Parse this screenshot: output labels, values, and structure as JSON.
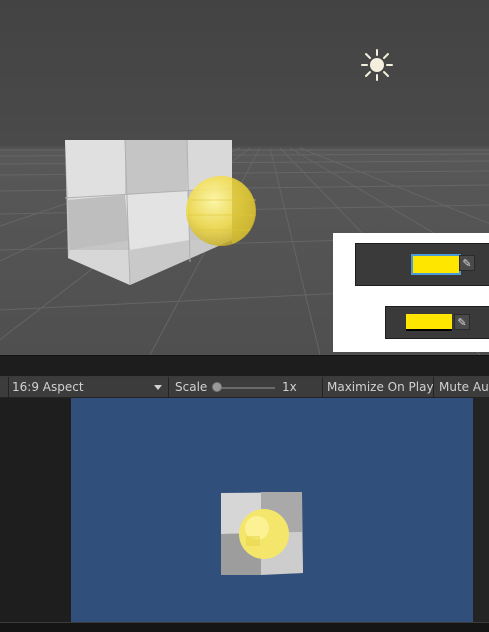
{
  "toolbar": {
    "aspect": "16:9 Aspect",
    "scale_label": "Scale",
    "scale_value": "1x",
    "maximize": "Maximize On Play",
    "mute": "Mute Audio"
  },
  "colors": {
    "swatch": "#ffe600",
    "game_background": "#30507b",
    "sphere": "#f5e04a"
  },
  "icons": [
    "sun-light-icon",
    "eyedropper-icon",
    "dropdown-arrow-icon"
  ]
}
